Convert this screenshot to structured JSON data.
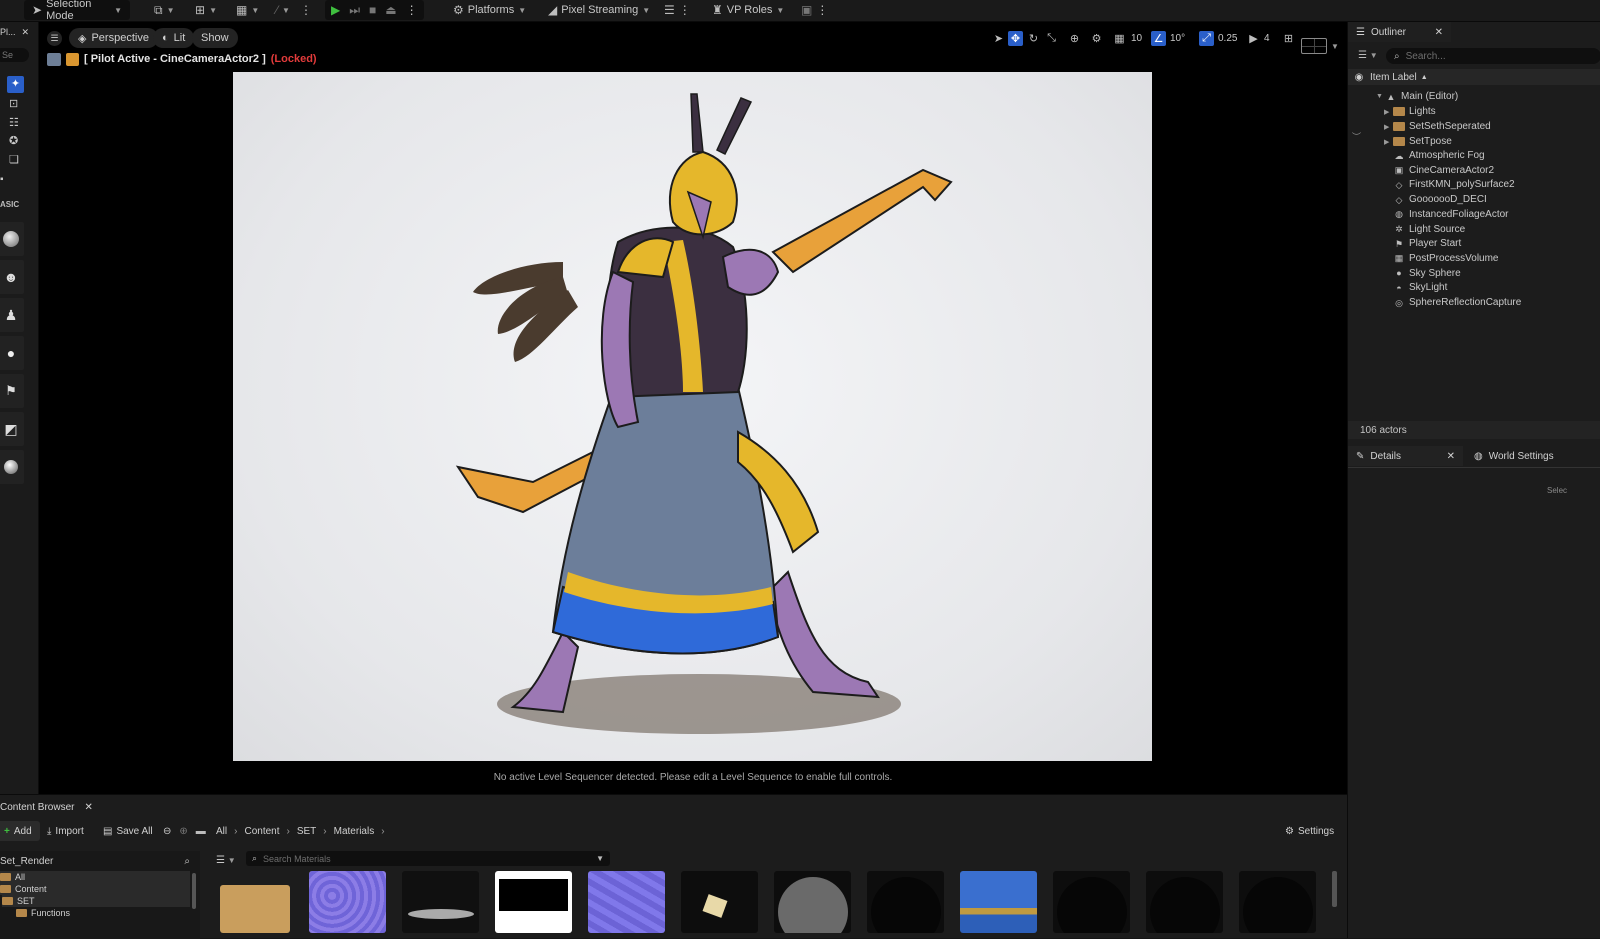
{
  "topbar": {
    "selection_mode": "Selection Mode",
    "platforms": "Platforms",
    "pixel_streaming": "Pixel Streaming",
    "vp_roles": "VP Roles"
  },
  "left_panel": {
    "tab_label": "Pl...",
    "search_placeholder": "Se",
    "section_label": "ASIC"
  },
  "viewport": {
    "perspective": "Perspective",
    "lit": "Lit",
    "show": "Show",
    "grid_snap": "10",
    "rotation_snap": "10°",
    "scale_snap": "0.25",
    "camera_speed": "4",
    "pilot_label": "[ Pilot Active - CineCameraActor2 ]",
    "locked_label": "(Locked)",
    "sequencer_message": "No active Level Sequencer detected. Please edit a Level Sequence to enable full controls."
  },
  "outliner": {
    "tab": "Outliner",
    "search_placeholder": "Search...",
    "column": "Item Label",
    "root": "Main (Editor)",
    "folders": [
      "Lights",
      "SetSethSeperated",
      "SetTpose"
    ],
    "actors": [
      "Atmospheric Fog",
      "CineCameraActor2",
      "FirstKMN_polySurface2",
      "GooooooD_DECI",
      "InstancedFoliageActor",
      "Light Source",
      "Player Start",
      "PostProcessVolume",
      "Sky Sphere",
      "SkyLight",
      "SphereReflectionCapture"
    ],
    "actor_count": "106 actors"
  },
  "details": {
    "tab": "Details",
    "world_settings": "World Settings",
    "hint": "Selec"
  },
  "content_browser": {
    "tab": "Content Browser",
    "add": "Add",
    "import": "Import",
    "save_all": "Save All",
    "breadcrumbs": [
      "All",
      "Content",
      "SET",
      "Materials"
    ],
    "settings": "Settings",
    "tree_search": "Set_Render",
    "tree": [
      "All",
      "Content",
      "SET",
      "Functions"
    ],
    "search_placeholder": "Search Materials"
  },
  "colors": {
    "accent_blue": "#2a5fc9",
    "locked_red": "#e23b3b",
    "play_green": "#3fbf3f",
    "folder": "#b4874a"
  }
}
